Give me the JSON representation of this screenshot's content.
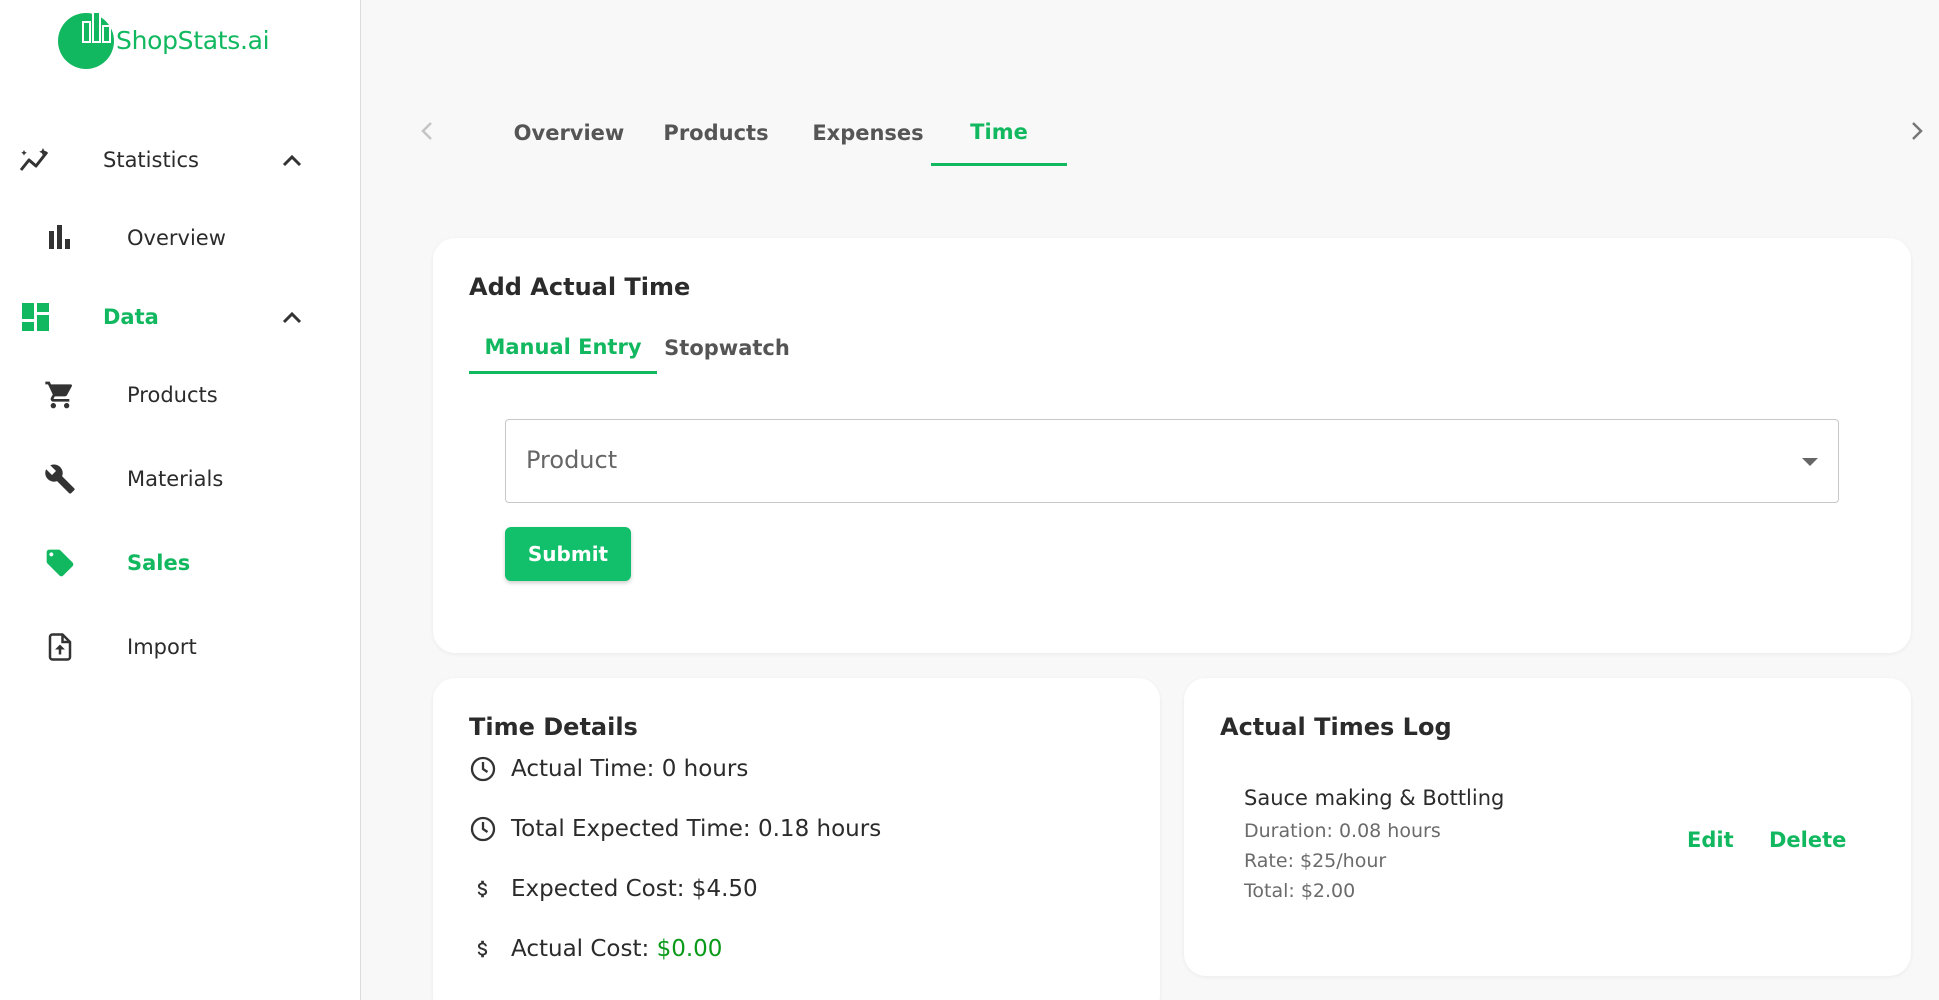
{
  "brand": {
    "name": "ShopStats.ai",
    "color": "#12b85f"
  },
  "sidebar": {
    "items": [
      {
        "label": "Statistics",
        "icon": "trend-icon"
      },
      {
        "label": "Overview",
        "icon": "bar-chart-icon"
      },
      {
        "label": "Data",
        "icon": "dashboard-icon"
      },
      {
        "label": "Products",
        "icon": "cart-icon"
      },
      {
        "label": "Materials",
        "icon": "wrench-icon"
      },
      {
        "label": "Sales",
        "icon": "tag-icon"
      },
      {
        "label": "Import",
        "icon": "file-upload-icon"
      }
    ]
  },
  "top_tabs": [
    "Overview",
    "Products",
    "Expenses",
    "Time"
  ],
  "top_tabs_active": "Time",
  "add_time": {
    "title": "Add Actual Time",
    "tabs": [
      "Manual Entry",
      "Stopwatch"
    ],
    "active_tab": "Manual Entry",
    "product_placeholder": "Product",
    "submit_label": "Submit"
  },
  "time_details": {
    "title": "Time Details",
    "actual_time": "Actual Time: 0 hours",
    "total_expected_time": "Total Expected Time: 0.18 hours",
    "expected_cost": "Expected Cost: $4.50",
    "actual_cost_label": "Actual Cost: ",
    "actual_cost_value": "$0.00"
  },
  "log": {
    "title": "Actual Times Log",
    "entries": [
      {
        "name": "Sauce making & Bottling",
        "duration": "Duration: 0.08 hours",
        "rate": "Rate: $25/hour",
        "total": "Total: $2.00",
        "edit_label": "Edit",
        "delete_label": "Delete"
      }
    ]
  }
}
